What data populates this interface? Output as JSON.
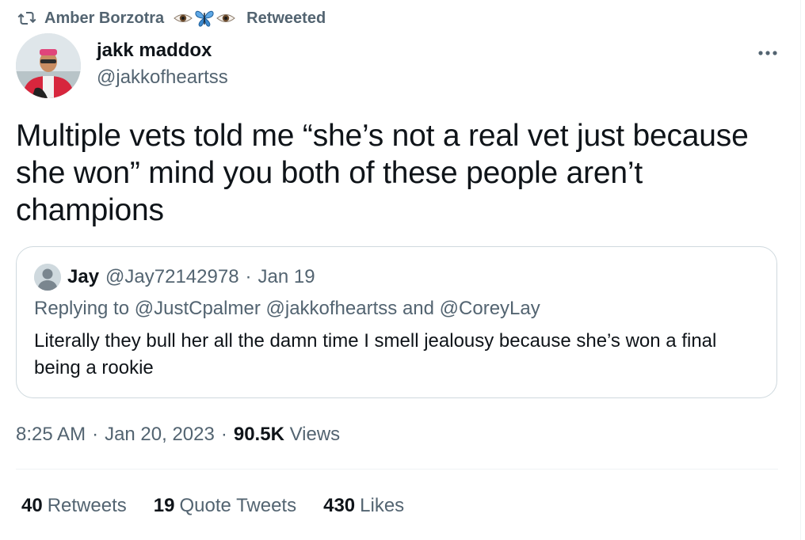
{
  "retweet_context": {
    "user": "Amber Borzotra",
    "label": "Retweeted"
  },
  "author": {
    "display_name": "jakk maddox",
    "handle": "@jakkofheartss"
  },
  "tweet": {
    "text": "Multiple vets told me “she’s not a real vet just because she won” mind you both of these people aren’t champions"
  },
  "quote": {
    "name": "Jay",
    "handle": "@Jay72142978",
    "separator": "·",
    "date": "Jan 19",
    "replying_prefix": "Replying to",
    "mention_1": "@JustCpalmer",
    "mention_2": "@jakkofheartss",
    "and_word": "and",
    "mention_3": "@CoreyLay",
    "text": "Literally they bull her all the damn time I smell jealousy because she’s won a final being a rookie"
  },
  "meta": {
    "time": "8:25 AM",
    "separator": "·",
    "date": "Jan 20, 2023",
    "views_count": "90.5K",
    "views_label": "Views"
  },
  "stats": {
    "retweets_count": "40",
    "retweets_label": "Retweets",
    "quotes_count": "19",
    "quotes_label": "Quote Tweets",
    "likes_count": "430",
    "likes_label": "Likes"
  },
  "colors": {
    "text_primary": "#0f1419",
    "text_secondary": "#536471",
    "border": "#cfd9de",
    "divider": "#eff3f4"
  },
  "icons": {
    "retweet": "retweet-icon",
    "more": "more-dots-icon",
    "context_emoji": [
      "eye-icon",
      "butterfly-icon",
      "eye-icon"
    ]
  }
}
